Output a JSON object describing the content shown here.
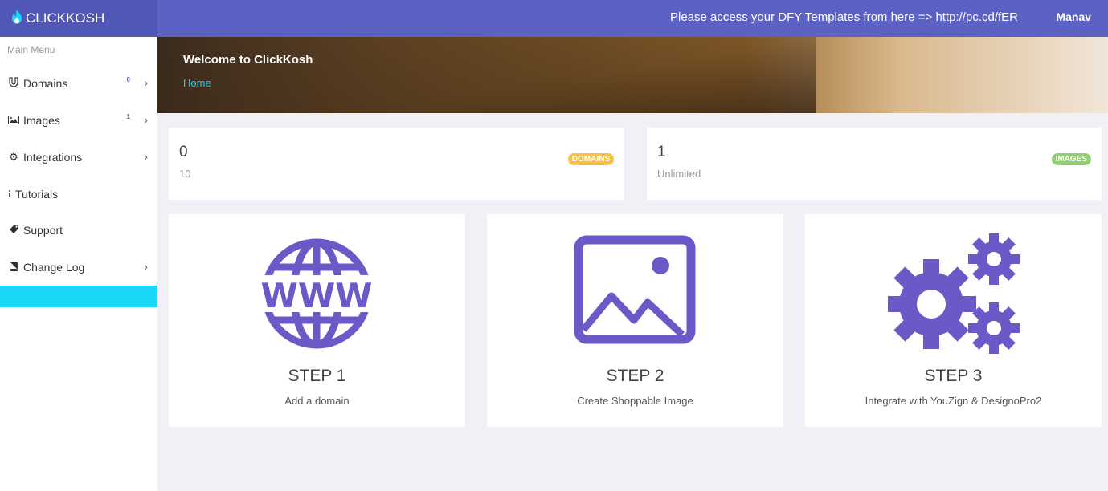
{
  "brand": {
    "name": "CLICKKOSH",
    "icon": "flame-icon"
  },
  "topbar": {
    "notice_text": "Please access your DFY Templates from here => ",
    "notice_link": "http://pc.cd/fER",
    "user": "Manav"
  },
  "sidebar": {
    "heading": "Main Menu",
    "items": [
      {
        "label": "Domains",
        "icon": "magnet-icon",
        "badge": "0",
        "chevron": "›"
      },
      {
        "label": "Images",
        "icon": "image-icon",
        "badge": "1",
        "chevron": "›"
      },
      {
        "label": "Integrations",
        "icon": "cogs-icon",
        "badge": "",
        "chevron": "›"
      },
      {
        "label": "Tutorials",
        "icon": "info-icon",
        "badge": "",
        "chevron": ""
      },
      {
        "label": "Support",
        "icon": "tag-icon",
        "badge": "",
        "chevron": ""
      },
      {
        "label": "Change Log",
        "icon": "book-icon",
        "badge": "",
        "chevron": "›"
      }
    ]
  },
  "hero": {
    "title": "Welcome to ClickKosh",
    "breadcrumb": "Home"
  },
  "stats": [
    {
      "value": "0",
      "limit": "10",
      "tag": "DOMAINS",
      "tag_color": "#f7c244"
    },
    {
      "value": "1",
      "limit": "Unlimited",
      "tag": "IMAGES",
      "tag_color": "#8fd16f"
    }
  ],
  "steps": [
    {
      "title": "STEP 1",
      "desc": "Add a domain",
      "icon": "www-globe-icon"
    },
    {
      "title": "STEP 2",
      "desc": "Create Shoppable Image",
      "icon": "picture-icon"
    },
    {
      "title": "STEP 3",
      "desc": "Integrate with YouZign & DesignoPro2",
      "icon": "gears-icon"
    }
  ],
  "colors": {
    "accent": "#5c62c3",
    "active": "#19d7f5",
    "icon": "#6a5ac8"
  }
}
